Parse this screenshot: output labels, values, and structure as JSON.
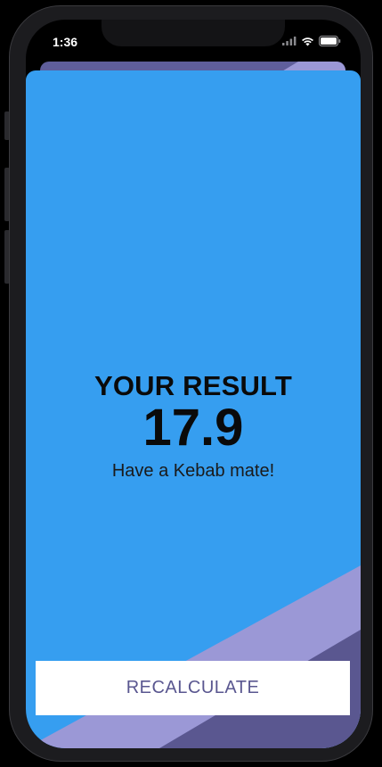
{
  "status_bar": {
    "time": "1:36"
  },
  "result": {
    "title": "YOUR RESULT",
    "value": "17.9",
    "message": "Have a Kebab mate!"
  },
  "actions": {
    "recalculate_label": "RECALCULATE"
  },
  "theme": {
    "card_blue": "#369ef0",
    "stripe_light": "#9b98d6",
    "stripe_dark": "#5a5790",
    "button_text": "#5a5790"
  },
  "icons": {
    "signal": "signal-icon",
    "wifi": "wifi-icon",
    "battery": "battery-icon"
  }
}
